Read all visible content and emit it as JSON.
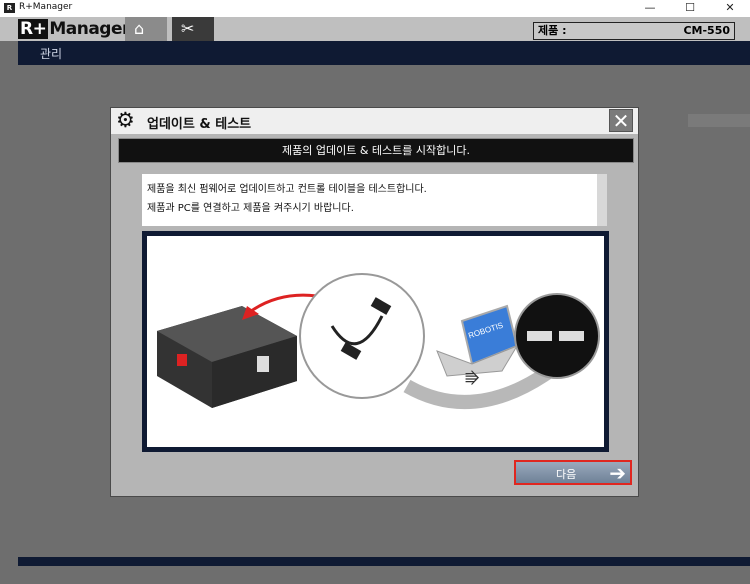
{
  "window": {
    "title": "R+Manager",
    "minimize": "—",
    "maximize": "☐",
    "close": "✕"
  },
  "app": {
    "logo": "Manager",
    "logo_prefix": "R+",
    "product_label": "제품 :",
    "product_value": "CM-550"
  },
  "nav": {
    "home_icon": "home-icon",
    "tools_icon": "tools-icon"
  },
  "menu": {
    "manage": "관리"
  },
  "dialog": {
    "title": "업데이트 & 테스트",
    "close": "✕",
    "banner": "제품의 업데이트 & 테스트를 시작합니다.",
    "desc_line1": "제품을 최신 펌웨어로 업데이트하고 컨트롤 테이블을 테스트합니다.",
    "desc_line2": "제품과 PC를 연결하고 제품을 켜주시기 바랍니다.",
    "illustration_brand": "ROBOTIS",
    "next_label": "다음",
    "next_arrow": "➔"
  },
  "colors": {
    "navy": "#0f1a33",
    "highlight": "#e0261f",
    "dialog_bg": "#b5b5b5"
  }
}
